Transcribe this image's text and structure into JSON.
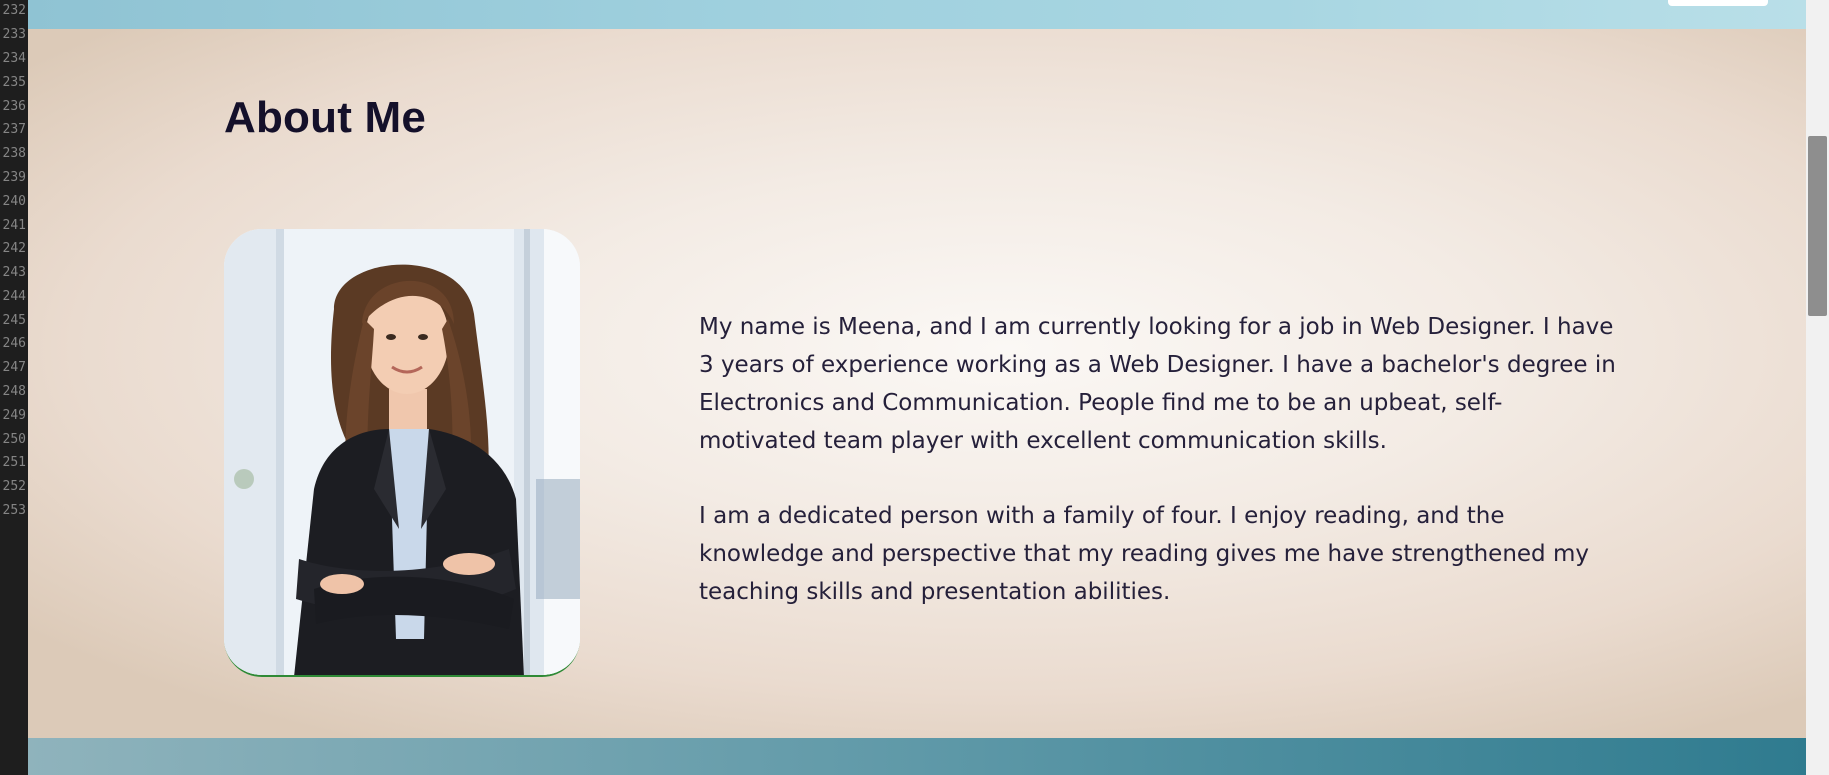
{
  "editor_gutter": {
    "line_numbers": [
      "232",
      "233",
      "234",
      "235",
      "236",
      "237",
      "238",
      "239",
      "240",
      "241",
      "242",
      "243",
      "244",
      "245",
      "246",
      "247",
      "248",
      "249",
      "250",
      "251",
      "252",
      "253"
    ]
  },
  "about": {
    "title": "About Me",
    "paragraphs": [
      "My name is Meena, and I am currently looking for a job in Web Designer. I have 3 years of experience working as a Web Designer. I have a bachelor's degree in Electronics and Communication. People find me to be an upbeat, self-motivated team player with excellent communication skills.",
      "I am a dedicated person with a family of four. I enjoy reading, and the knowledge and perspective that my reading gives me have strengthened my teaching skills and presentation abilities."
    ],
    "photo_icon": "profile-photo"
  },
  "colors": {
    "title": "#14102a",
    "body_text": "#25203a",
    "section_bg": "#f3ebe4",
    "top_band": "#9fd0de",
    "bottom_band": "#2f7b8f"
  }
}
